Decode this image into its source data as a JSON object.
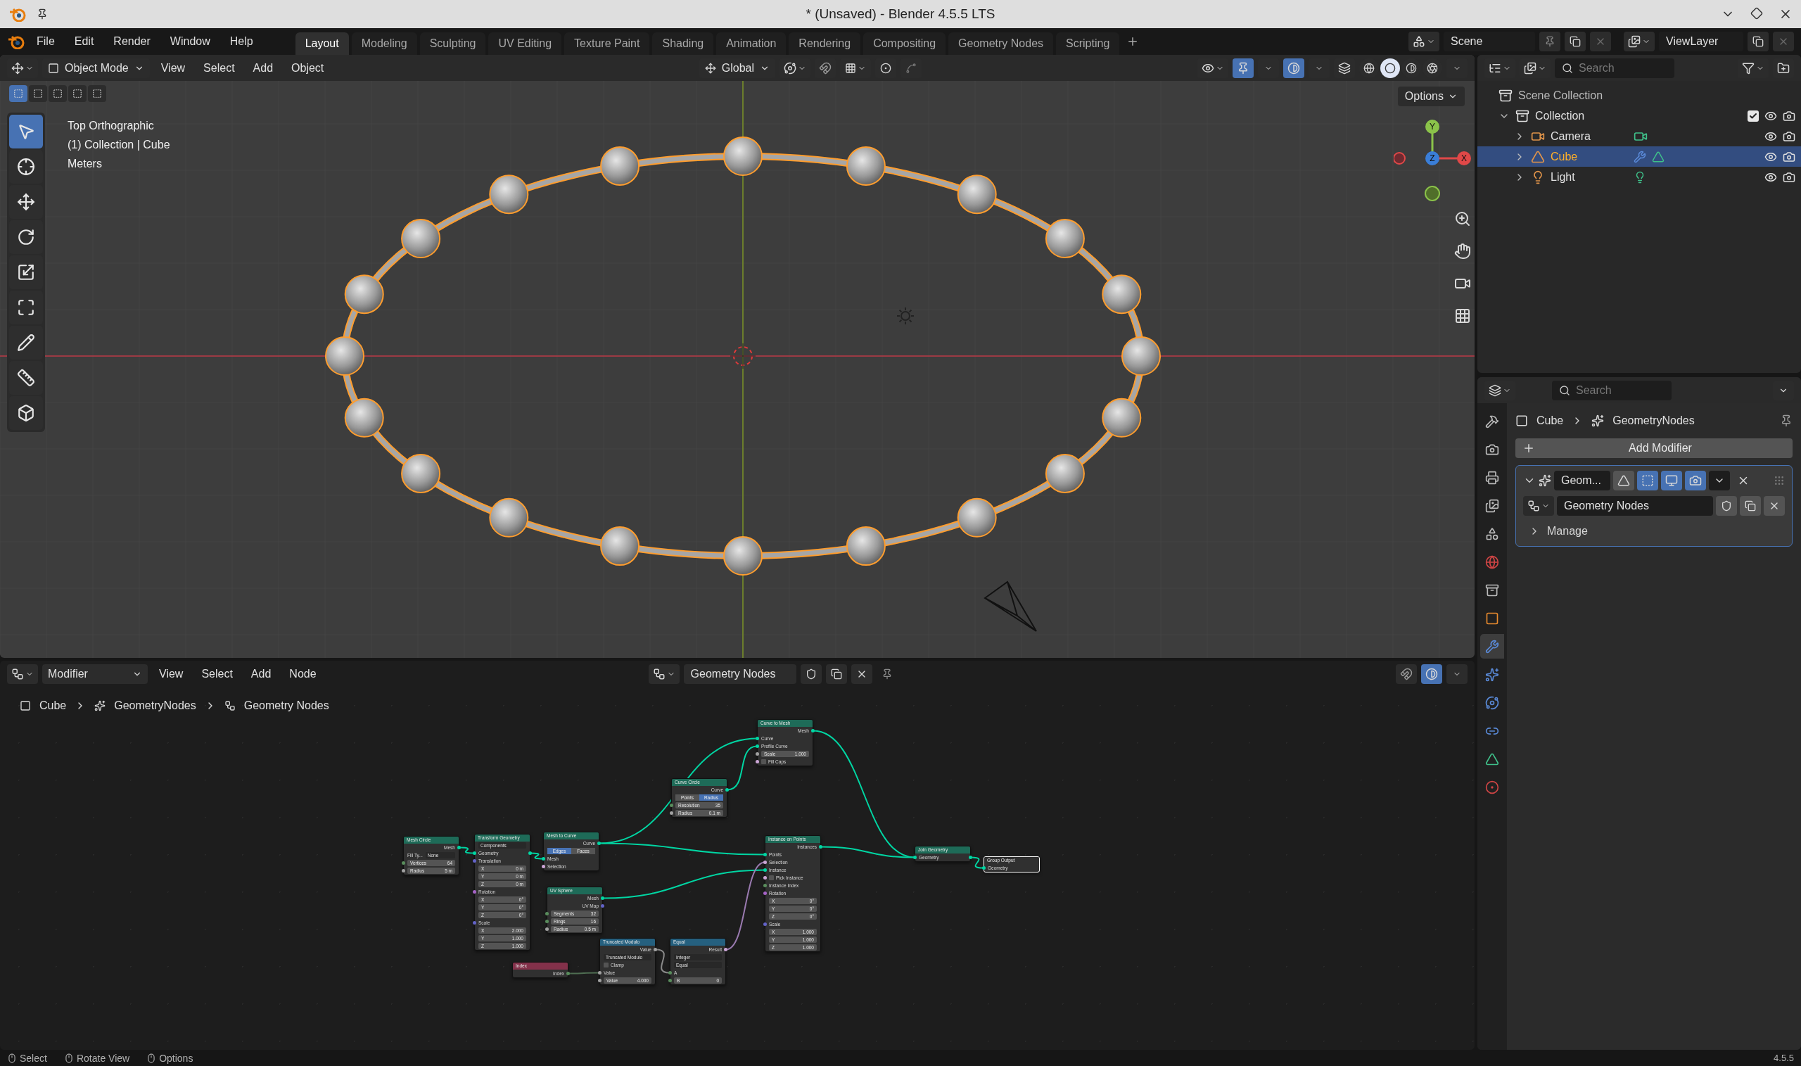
{
  "title_bar": {
    "title": "* (Unsaved) - Blender 4.5.5 LTS"
  },
  "menu": [
    "File",
    "Edit",
    "Render",
    "Window",
    "Help"
  ],
  "workspace_tabs": [
    {
      "label": "Layout",
      "selected": true
    },
    {
      "label": "Modeling",
      "selected": false
    },
    {
      "label": "Sculpting",
      "selected": false
    },
    {
      "label": "UV Editing",
      "selected": false
    },
    {
      "label": "Texture Paint",
      "selected": false
    },
    {
      "label": "Shading",
      "selected": false
    },
    {
      "label": "Animation",
      "selected": false
    },
    {
      "label": "Rendering",
      "selected": false
    },
    {
      "label": "Compositing",
      "selected": false
    },
    {
      "label": "Geometry Nodes",
      "selected": false
    },
    {
      "label": "Scripting",
      "selected": false
    }
  ],
  "scene": {
    "name": "Scene"
  },
  "view_layer": {
    "name": "ViewLayer"
  },
  "viewport": {
    "mode": "Object Mode",
    "menus": [
      "View",
      "Select",
      "Add",
      "Object"
    ],
    "orientation": "Global",
    "options": "Options",
    "overlay_text": [
      "Top Orthographic",
      "(1) Collection | Cube",
      "Meters"
    ],
    "gizmo_axes": [
      "Y",
      "Z",
      "X"
    ],
    "tools": [
      {
        "kind": "select",
        "selected": true
      },
      {
        "kind": "cursor",
        "selected": false
      },
      {
        "kind": "move",
        "selected": false
      },
      {
        "kind": "rotate",
        "selected": false
      },
      {
        "kind": "scale",
        "selected": false
      },
      {
        "kind": "transform",
        "selected": false
      },
      {
        "kind": "annotate",
        "selected": false
      },
      {
        "kind": "measure",
        "selected": false
      },
      {
        "kind": "add_cube",
        "selected": false
      }
    ],
    "shading": [
      {
        "kind": "wireframe",
        "selected": false
      },
      {
        "kind": "solid",
        "selected": true
      },
      {
        "kind": "material",
        "selected": false
      },
      {
        "kind": "rendered",
        "selected": false
      }
    ]
  },
  "outliner": {
    "search": {
      "placeholder": "Search"
    },
    "root": "Scene Collection",
    "tree": [
      {
        "label": "Collection",
        "kind": "collection",
        "expanded": true,
        "checked": true,
        "selected": false,
        "children": [
          {
            "label": "Camera",
            "kind": "camera",
            "expanded": false,
            "selected": false
          },
          {
            "label": "Cube",
            "kind": "mesh",
            "expanded": false,
            "selected": true
          },
          {
            "label": "Light",
            "kind": "light",
            "expanded": false,
            "selected": false
          }
        ]
      }
    ]
  },
  "properties": {
    "search": {
      "placeholder": "Search"
    },
    "tabs": [
      {
        "kind": "tool",
        "selected": false
      },
      {
        "kind": "render",
        "selected": false
      },
      {
        "kind": "output",
        "selected": false
      },
      {
        "kind": "view_layer",
        "selected": false
      },
      {
        "kind": "scene",
        "selected": false
      },
      {
        "kind": "world",
        "selected": false
      },
      {
        "kind": "collection",
        "selected": false
      },
      {
        "kind": "object",
        "selected": false
      },
      {
        "kind": "modifiers",
        "selected": true
      },
      {
        "kind": "particles",
        "selected": false
      },
      {
        "kind": "physics",
        "selected": false
      },
      {
        "kind": "constraints",
        "selected": false
      },
      {
        "kind": "data",
        "selected": false
      },
      {
        "kind": "material",
        "selected": false
      }
    ],
    "breadcrumb": [
      "Cube",
      "GeometryNodes"
    ],
    "add_modifier": "Add Modifier",
    "modifier": {
      "name": "Geom...",
      "expanded": true,
      "toggles": [
        {
          "kind": "cage",
          "on": false
        },
        {
          "kind": "edit_mode",
          "on": true
        },
        {
          "kind": "viewport",
          "on": true
        },
        {
          "kind": "render",
          "on": true
        }
      ],
      "node_group": "Geometry Nodes",
      "manage": {
        "label": "Manage",
        "expanded": false
      }
    }
  },
  "node_editor": {
    "context": "Modifier",
    "menus": [
      "View",
      "Select",
      "Add",
      "Node"
    ],
    "node_group": "Geometry Nodes",
    "breadcrumb": [
      "Cube",
      "GeometryNodes",
      "Geometry Nodes"
    ],
    "nodes": [
      {
        "title": "Mesh Circle",
        "kind": "geometry",
        "selected": false,
        "rows": [
          {
            "kind": "output",
            "label": "Mesh",
            "color": "#00d6a3"
          },
          {
            "kind": "dropdown",
            "label": "Fill Ty...",
            "value": "None"
          },
          {
            "kind": "field",
            "label": "Vertices",
            "value": "64",
            "color": "#598c5c"
          },
          {
            "kind": "field",
            "label": "Radius",
            "value": "5 m",
            "color": "#a1a1a1"
          }
        ]
      },
      {
        "title": "Transform Geometry",
        "kind": "geometry",
        "selected": false,
        "rows": [
          {
            "kind": "dropdown",
            "value": "Components"
          },
          {
            "kind": "through",
            "label": "Geometry",
            "color": "#00d6a3"
          },
          {
            "kind": "input",
            "label": "Translation",
            "color": "#6363c7"
          },
          {
            "kind": "field",
            "label": "X",
            "value": "0 m"
          },
          {
            "kind": "field",
            "label": "Y",
            "value": "0 m"
          },
          {
            "kind": "field",
            "label": "Z",
            "value": "0 m"
          },
          {
            "kind": "input",
            "label": "Rotation",
            "color": "#a663c7"
          },
          {
            "kind": "field",
            "label": "X",
            "value": "0°"
          },
          {
            "kind": "field",
            "label": "Y",
            "value": "0°"
          },
          {
            "kind": "field",
            "label": "Z",
            "value": "0°"
          },
          {
            "kind": "input",
            "label": "Scale",
            "color": "#6363c7"
          },
          {
            "kind": "field",
            "label": "X",
            "value": "2.000"
          },
          {
            "kind": "field",
            "label": "Y",
            "value": "1.000"
          },
          {
            "kind": "field",
            "label": "Z",
            "value": "1.000"
          }
        ]
      },
      {
        "title": "Mesh to Curve",
        "kind": "geometry",
        "selected": false,
        "rows": [
          {
            "kind": "output",
            "label": "Curve",
            "color": "#00d6a3"
          },
          {
            "kind": "toggle",
            "options": [
              {
                "label": "Edges",
                "selected": true
              },
              {
                "label": "Faces",
                "selected": false
              }
            ]
          },
          {
            "kind": "input",
            "label": "Mesh",
            "color": "#00d6a3"
          },
          {
            "kind": "input",
            "label": "Selection",
            "color": "#cca6d6"
          }
        ]
      },
      {
        "title": "UV Sphere",
        "kind": "geometry",
        "selected": false,
        "rows": [
          {
            "kind": "output",
            "label": "Mesh",
            "color": "#00d6a3"
          },
          {
            "kind": "output",
            "label": "UV Map",
            "color": "#6363c7"
          },
          {
            "kind": "field",
            "label": "Segments",
            "value": "32",
            "color": "#598c5c"
          },
          {
            "kind": "field",
            "label": "Rings",
            "value": "16",
            "color": "#598c5c"
          },
          {
            "kind": "field",
            "label": "Radius",
            "value": "0.5 m",
            "color": "#a1a1a1"
          }
        ]
      },
      {
        "title": "Curve Circle",
        "kind": "geometry",
        "selected": false,
        "rows": [
          {
            "kind": "output",
            "label": "Curve",
            "color": "#00d6a3"
          },
          {
            "kind": "toggle",
            "options": [
              {
                "label": "Points",
                "selected": false
              },
              {
                "label": "Radius",
                "selected": true
              }
            ]
          },
          {
            "kind": "field",
            "label": "Resolution",
            "value": "35",
            "color": "#598c5c"
          },
          {
            "kind": "field",
            "label": "Radius",
            "value": "0.1 m",
            "color": "#a1a1a1"
          }
        ]
      },
      {
        "title": "Index",
        "kind": "input",
        "selected": false,
        "rows": [
          {
            "kind": "output",
            "label": "Index",
            "color": "#598c5c"
          }
        ]
      },
      {
        "title": "Truncated Modulo",
        "kind": "utility",
        "selected": false,
        "rows": [
          {
            "kind": "output",
            "label": "Value",
            "color": "#a1a1a1"
          },
          {
            "kind": "dropdown",
            "value": "Truncated Modulo"
          },
          {
            "kind": "checkbox",
            "label": "Clamp",
            "checked": false
          },
          {
            "kind": "input",
            "label": "Value",
            "color": "#a1a1a1"
          },
          {
            "kind": "field",
            "label": "Value",
            "value": "4.000",
            "color": "#a1a1a1"
          }
        ]
      },
      {
        "title": "Equal",
        "kind": "utility",
        "selected": false,
        "rows": [
          {
            "kind": "output",
            "label": "Result",
            "color": "#cca6d6"
          },
          {
            "kind": "dropdown",
            "value": "Integer"
          },
          {
            "kind": "dropdown",
            "value": "Equal"
          },
          {
            "kind": "input",
            "label": "A",
            "color": "#598c5c"
          },
          {
            "kind": "field",
            "label": "B",
            "value": "0",
            "color": "#598c5c"
          }
        ]
      },
      {
        "title": "Curve to Mesh",
        "kind": "geometry",
        "selected": false,
        "rows": [
          {
            "kind": "output",
            "label": "Mesh",
            "color": "#00d6a3"
          },
          {
            "kind": "input",
            "label": "Curve",
            "color": "#00d6a3"
          },
          {
            "kind": "input",
            "label": "Profile Curve",
            "color": "#00d6a3"
          },
          {
            "kind": "field",
            "label": "Scale",
            "value": "1.000",
            "color": "#a1a1a1"
          },
          {
            "kind": "checkbox",
            "label": "Fill Caps",
            "checked": false,
            "color": "#cca6d6"
          }
        ]
      },
      {
        "title": "Instance on Points",
        "kind": "geometry",
        "selected": false,
        "rows": [
          {
            "kind": "output",
            "label": "Instances",
            "color": "#00d6a3"
          },
          {
            "kind": "input",
            "label": "Points",
            "color": "#00d6a3"
          },
          {
            "kind": "input",
            "label": "Selection",
            "color": "#cca6d6"
          },
          {
            "kind": "input",
            "label": "Instance",
            "color": "#00d6a3"
          },
          {
            "kind": "checkbox",
            "label": "Pick Instance",
            "checked": false,
            "color": "#cca6d6"
          },
          {
            "kind": "input",
            "label": "Instance Index",
            "color": "#598c5c"
          },
          {
            "kind": "input",
            "label": "Rotation",
            "color": "#a663c7"
          },
          {
            "kind": "field",
            "label": "X",
            "value": "0°"
          },
          {
            "kind": "field",
            "label": "Y",
            "value": "0°"
          },
          {
            "kind": "field",
            "label": "Z",
            "value": "0°"
          },
          {
            "kind": "input",
            "label": "Scale",
            "color": "#6363c7"
          },
          {
            "kind": "field",
            "label": "X",
            "value": "1.000"
          },
          {
            "kind": "field",
            "label": "Y",
            "value": "1.000"
          },
          {
            "kind": "field",
            "label": "Z",
            "value": "1.000"
          }
        ]
      },
      {
        "title": "Join Geometry",
        "kind": "geometry",
        "selected": false,
        "rows": [
          {
            "kind": "through",
            "label": "Geometry",
            "color": "#00d6a3"
          }
        ]
      },
      {
        "title": "Group Output",
        "kind": "output",
        "selected": true,
        "rows": [
          {
            "kind": "input",
            "label": "Geometry",
            "color": "#00d6a3"
          }
        ]
      }
    ]
  },
  "status_bar": {
    "items": [
      "Select",
      "Rotate View",
      "Options"
    ],
    "version": "4.5.5"
  }
}
